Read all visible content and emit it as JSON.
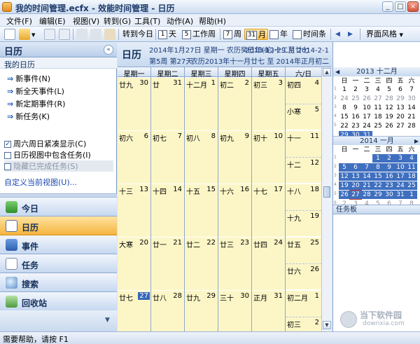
{
  "window": {
    "title": "我的时间管理.ecfx - 效能时间管理 - 日历",
    "min": "_",
    "max": "□",
    "close": "×"
  },
  "menu": [
    "文件(F)",
    "编辑(E)",
    "视图(V)",
    "转到(G)",
    "工具(T)",
    "动作(A)",
    "帮助(H)"
  ],
  "toolbar": {
    "today": "转到今日",
    "day": "天",
    "day_num": "1",
    "workweek": "工作周",
    "workweek_num": "5",
    "week": "周",
    "week_num": "7",
    "month": "月",
    "month_num": "31",
    "year": "年",
    "timeline": "时间条",
    "style": "界面风格"
  },
  "left": {
    "title": "日历",
    "section": "我的日历",
    "links": [
      "新事件(N)",
      "新全天事件(L)",
      "新定期事件(R)",
      "新任务(K)"
    ],
    "checks": [
      {
        "label": "周六周日紧凑显示(C)",
        "checked": true
      },
      {
        "label": "日历视图中包含任务(I)",
        "checked": false
      },
      {
        "label": "隐藏已完成任务(S)",
        "checked": false
      }
    ],
    "custom": "自定义当前视图(U)...",
    "nav": [
      "今日",
      "日历",
      "事件",
      "任务",
      "搜索",
      "回收站"
    ]
  },
  "calendar": {
    "title": "日历",
    "info1": "2014年1月27日 星期一 农历癸巳年(蛇)十二月廿七",
    "info2": "第5周 第27天",
    "range1": "2013-12-29 至 2014-2-1",
    "range2": "农历2013年十一月廿七 至 2014年正月初二",
    "weekdays": [
      "星期一",
      "星期二",
      "星期三",
      "星期四",
      "星期五",
      "六/日"
    ],
    "weeks": [
      [
        {
          "l": "廿九",
          "n": "30"
        },
        {
          "l": "廿",
          "n": "31"
        },
        {
          "l": "十二月",
          "n": "1"
        },
        {
          "l": "初二",
          "n": "2"
        },
        {
          "l": "初三",
          "n": "3"
        },
        {
          "s": [
            {
              "l": "初四",
              "n": "4"
            },
            {
              "l": "小寒",
              "n": "5"
            }
          ]
        }
      ],
      [
        {
          "l": "初六",
          "n": "6"
        },
        {
          "l": "初七",
          "n": "7"
        },
        {
          "l": "初八",
          "n": "8"
        },
        {
          "l": "初九",
          "n": "9"
        },
        {
          "l": "初十",
          "n": "10"
        },
        {
          "s": [
            {
              "l": "十一",
              "n": "11"
            },
            {
              "l": "十二",
              "n": "12"
            }
          ]
        }
      ],
      [
        {
          "l": "十三",
          "n": "13"
        },
        {
          "l": "十四",
          "n": "14"
        },
        {
          "l": "十五",
          "n": "15"
        },
        {
          "l": "十六",
          "n": "16"
        },
        {
          "l": "十七",
          "n": "17"
        },
        {
          "s": [
            {
              "l": "十八",
              "n": "18"
            },
            {
              "l": "十九",
              "n": "19"
            }
          ]
        }
      ],
      [
        {
          "l": "大寒",
          "n": "20"
        },
        {
          "l": "廿一",
          "n": "21"
        },
        {
          "l": "廿二",
          "n": "22"
        },
        {
          "l": "廿三",
          "n": "23"
        },
        {
          "l": "廿四",
          "n": "24"
        },
        {
          "s": [
            {
              "l": "廿五",
              "n": "25"
            },
            {
              "l": "廿六",
              "n": "26"
            }
          ]
        }
      ],
      [
        {
          "l": "廿七",
          "n": "27",
          "today": true
        },
        {
          "l": "廿八",
          "n": "28"
        },
        {
          "l": "廿九",
          "n": "29"
        },
        {
          "l": "三十",
          "n": "30"
        },
        {
          "l": "正月",
          "n": "31"
        },
        {
          "s": [
            {
              "l": "初二月",
              "n": "1"
            },
            {
              "l": "初三",
              "n": "2"
            }
          ]
        }
      ]
    ]
  },
  "minical": {
    "dow": [
      "日",
      "一",
      "二",
      "三",
      "四",
      "五",
      "六"
    ],
    "m1": {
      "title": "2013 十二月",
      "weeks": [
        "1",
        "2",
        "3",
        "4",
        "5"
      ],
      "rows": [
        [
          {
            "d": "1"
          },
          {
            "d": "2"
          },
          {
            "d": "3"
          },
          {
            "d": "4"
          },
          {
            "d": "5"
          },
          {
            "d": "6"
          },
          {
            "d": "7"
          }
        ],
        [
          {
            "d": "24",
            "o": 1
          },
          {
            "d": "25",
            "o": 1
          },
          {
            "d": "26",
            "o": 1
          },
          {
            "d": "27",
            "o": 1
          },
          {
            "d": "28",
            "o": 1
          },
          {
            "d": "29",
            "o": 1
          },
          {
            "d": "30",
            "o": 1
          }
        ],
        [
          {
            "d": "8"
          },
          {
            "d": "9"
          },
          {
            "d": "10"
          },
          {
            "d": "11"
          },
          {
            "d": "12"
          },
          {
            "d": "13"
          },
          {
            "d": "14"
          }
        ],
        [
          {
            "d": "15"
          },
          {
            "d": "16"
          },
          {
            "d": "17"
          },
          {
            "d": "18"
          },
          {
            "d": "19"
          },
          {
            "d": "20"
          },
          {
            "d": "21"
          }
        ],
        [
          {
            "d": "22"
          },
          {
            "d": "23"
          },
          {
            "d": "24"
          },
          {
            "d": "25"
          },
          {
            "d": "26"
          },
          {
            "d": "27"
          },
          {
            "d": "28"
          }
        ],
        [
          {
            "d": "29",
            "s": 1
          },
          {
            "d": "30",
            "s": 1
          },
          {
            "d": "31",
            "s": 1
          }
        ]
      ]
    },
    "m2": {
      "title": "2014 一月",
      "weeks": [
        "1",
        "2",
        "3",
        "4",
        "5",
        "6"
      ],
      "rows": [
        [
          {
            "d": ""
          },
          {
            "d": ""
          },
          {
            "d": ""
          },
          {
            "d": "1",
            "s": 1
          },
          {
            "d": "2",
            "s": 1
          },
          {
            "d": "3",
            "s": 1
          },
          {
            "d": "4",
            "s": 1
          }
        ],
        [
          {
            "d": "5",
            "s": 1
          },
          {
            "d": "6",
            "s": 1
          },
          {
            "d": "7",
            "s": 1
          },
          {
            "d": "8",
            "s": 1
          },
          {
            "d": "9",
            "s": 1
          },
          {
            "d": "10",
            "s": 1
          },
          {
            "d": "11",
            "s": 1
          }
        ],
        [
          {
            "d": "12",
            "s": 1
          },
          {
            "d": "13",
            "s": 1
          },
          {
            "d": "14",
            "s": 1
          },
          {
            "d": "15",
            "s": 1
          },
          {
            "d": "16",
            "s": 1
          },
          {
            "d": "17",
            "s": 1
          },
          {
            "d": "18",
            "s": 1
          }
        ],
        [
          {
            "d": "19",
            "s": 1
          },
          {
            "d": "20",
            "s": 1
          },
          {
            "d": "21",
            "s": 1
          },
          {
            "d": "22",
            "s": 1
          },
          {
            "d": "23",
            "s": 1
          },
          {
            "d": "24",
            "s": 1
          },
          {
            "d": "25",
            "s": 1
          }
        ],
        [
          {
            "d": "26",
            "s": 1
          },
          {
            "d": "27",
            "s": 1,
            "t": 1
          },
          {
            "d": "28",
            "s": 1
          },
          {
            "d": "29",
            "s": 1
          },
          {
            "d": "30",
            "s": 1
          },
          {
            "d": "31",
            "s": 1
          },
          {
            "d": "1",
            "s": 1
          }
        ],
        [
          {
            "d": "2",
            "o": 1
          },
          {
            "d": "3",
            "o": 1
          },
          {
            "d": "4",
            "o": 1
          },
          {
            "d": "5",
            "o": 1
          },
          {
            "d": "6",
            "o": 1
          },
          {
            "d": "7",
            "o": 1
          },
          {
            "d": "8",
            "o": 1
          }
        ]
      ]
    },
    "taskboard": "任务板"
  },
  "status": "需要帮助，请按 F1",
  "watermark": {
    "name": "当下软件园",
    "url": "downxia.com"
  }
}
